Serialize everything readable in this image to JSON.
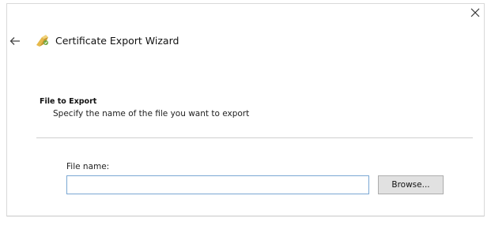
{
  "window": {
    "title": "Certificate Export Wizard",
    "icons": {
      "close": "close-icon",
      "back": "back-arrow-icon",
      "app": "certificate-icon"
    }
  },
  "section": {
    "heading": "File to Export",
    "description": "Specify the name of the file you want to export"
  },
  "form": {
    "file_name_label": "File name:",
    "file_name_value": "",
    "browse_label": "Browse..."
  },
  "colors": {
    "input_border": "#7aa7d3",
    "button_bg": "#e1e1e1",
    "separator": "#cfcfcf"
  }
}
